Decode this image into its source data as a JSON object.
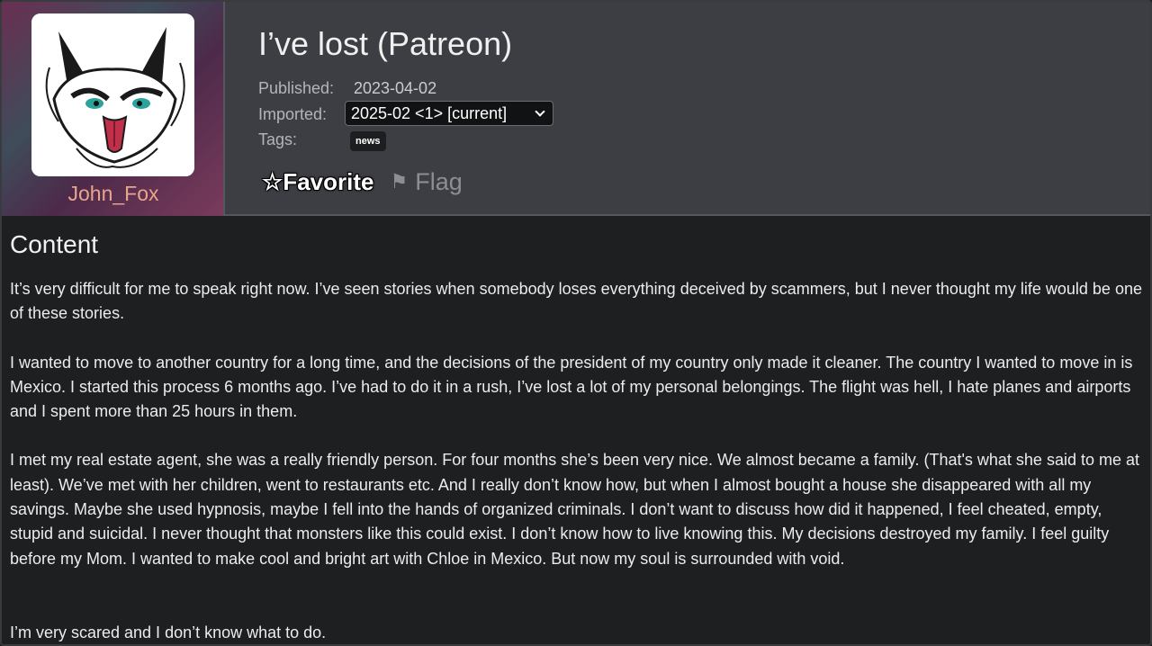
{
  "user": {
    "name": "John_Fox"
  },
  "post": {
    "title": "I’ve lost (Patreon)",
    "published_label": "Published:",
    "published_value": "2023-04-02",
    "imported_label": "Imported:",
    "imported_value": "2025-02 <1> [current]",
    "tags_label": "Tags:",
    "tags": [
      "news"
    ]
  },
  "actions": {
    "favorite_label": "Favorite",
    "favorite_icon": "☆",
    "flag_label": "Flag",
    "flag_icon": "⚑"
  },
  "content": {
    "heading": "Content",
    "paragraphs": [
      "It’s very difficult for me to speak right now. I’ve seen stories when somebody loses everything deceived by scammers, but I never thought my life would be one of these stories.",
      "I wanted to move to another country for a long time, and the decisions of the president of my country only made it cleaner. The country I wanted to move in is Mexico. I started this process 6 months ago. I’ve had to do it in a rush, I’ve lost a lot of my personal belongings. The flight was hell, I hate planes and airports and I spent more than 25 hours in them.",
      "I met my real estate agent, she was a really friendly person. For four months she’s been very nice. We almost became a family. (That's what she said to me at least). We’ve met with her children, went to restaurants etc. And I really don’t know how, but when I almost bought a house she disappeared with all my savings. Maybe she used hypnosis, maybe I fell into the hands of organized criminals. I don’t want to discuss how did it happened, I feel cheated, empty, stupid and suicidal. I never thought that monsters  like this could exist. I don’t know how to live knowing this. My decisions destroyed my family. I feel guilty before my Mom.  I wanted to make cool and bright art with Chloe in Mexico. But now my soul is surrounded with void.",
      "I’m very scared and I don’t know what to do."
    ]
  },
  "colors": {
    "header_bg": "#3c3e44",
    "page_bg": "#1e1f21",
    "username": "#e8a58c"
  }
}
